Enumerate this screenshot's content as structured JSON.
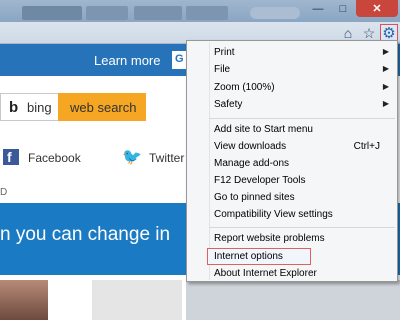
{
  "window": {
    "minimize_glyph": "—",
    "maximize_glyph": "□",
    "close_glyph": "✕"
  },
  "toolbar": {
    "home_glyph": "⌂",
    "favorites_glyph": "☆",
    "tools_glyph": "⚙"
  },
  "page": {
    "learn_more": "Learn more",
    "banner_box_char": "G",
    "bing_logo": "b",
    "bing_text": "bing",
    "search_button": "web search",
    "facebook_glyph": "f",
    "facebook_label": "Facebook",
    "twitter_glyph": "🐦",
    "twitter_label": "Twitter",
    "d_char": "D",
    "panel_text": "n you can change in"
  },
  "menu": {
    "items": [
      {
        "label": "Print",
        "submenu": true
      },
      {
        "label": "File",
        "submenu": true
      },
      {
        "label": "Zoom (100%)",
        "submenu": true
      },
      {
        "label": "Safety",
        "submenu": true
      },
      {
        "label": "Add site to Start menu"
      },
      {
        "label": "View downloads",
        "shortcut": "Ctrl+J"
      },
      {
        "label": "Manage add-ons"
      },
      {
        "label": "F12 Developer Tools"
      },
      {
        "label": "Go to pinned sites"
      },
      {
        "label": "Compatibility View settings"
      },
      {
        "label": "Report website problems"
      },
      {
        "label": "Internet options",
        "highlighted": true
      },
      {
        "label": "About Internet Explorer"
      }
    ],
    "submenu_arrow": "▶"
  },
  "colors": {
    "banner": "#2673b9",
    "search_button": "#f5a623",
    "panel": "#1a7ac4",
    "highlight_border": "#e06060",
    "close_button": "#c9463d"
  }
}
